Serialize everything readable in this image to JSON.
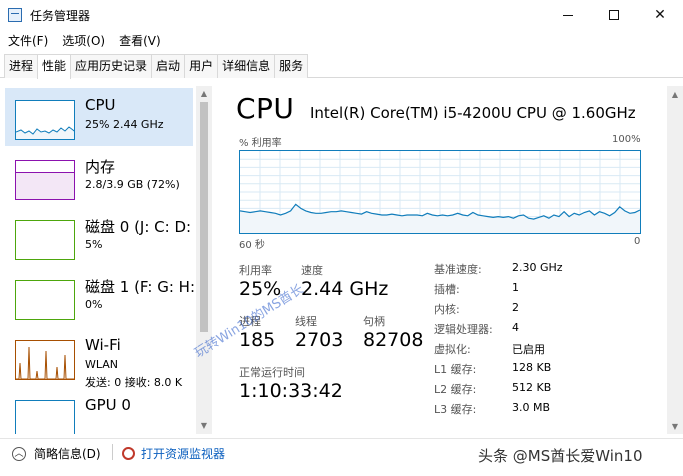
{
  "window": {
    "title": "任务管理器"
  },
  "menu": {
    "items": [
      "文件(F)",
      "选项(O)",
      "查看(V)"
    ]
  },
  "tabs": [
    "进程",
    "性能",
    "应用历史记录",
    "启动",
    "用户",
    "详细信息",
    "服务"
  ],
  "sidebar": {
    "items": [
      {
        "name": "CPU",
        "sub": "25% 2.44 GHz",
        "sub2": "",
        "color": "#117dbb"
      },
      {
        "name": "内存",
        "sub": "2.8/3.9 GB (72%)",
        "sub2": "",
        "color": "#8b12ae"
      },
      {
        "name": "磁盘 0 (J: C: D:",
        "sub": "5%",
        "sub2": "",
        "color": "#4da60c"
      },
      {
        "name": "磁盘 1 (F: G: H:",
        "sub": "0%",
        "sub2": "",
        "color": "#4da60c"
      },
      {
        "name": "Wi-Fi",
        "sub": "WLAN",
        "sub2": "发送: 0 接收: 8.0 K",
        "color": "#a74f01"
      },
      {
        "name": "GPU 0",
        "sub": "",
        "sub2": "",
        "color": "#117dbb"
      }
    ]
  },
  "main": {
    "title": "CPU",
    "model": "Intel(R) Core(TM) i5-4200U CPU @ 1.60GHz",
    "graph_label_left": "% 利用率",
    "graph_label_right": "100%",
    "time_left": "60 秒",
    "time_right": "0",
    "utilization_history_percent": [
      27,
      26,
      25,
      26,
      27,
      26,
      25,
      24,
      22,
      24,
      27,
      35,
      30,
      27,
      25,
      24,
      24,
      25,
      26,
      26,
      27,
      26,
      25,
      24,
      23,
      26,
      24,
      23,
      22,
      22,
      23,
      22,
      21,
      22,
      22,
      22,
      21,
      24,
      22,
      21,
      22,
      21,
      22,
      24,
      22,
      21,
      25,
      22,
      21,
      20,
      19,
      20,
      19,
      20,
      18,
      21,
      22,
      18,
      17,
      19,
      21,
      18,
      22,
      20,
      26,
      20,
      24,
      22,
      25,
      27,
      22,
      26,
      24,
      21,
      25,
      32,
      27,
      24,
      25,
      28
    ],
    "stats": {
      "util_label": "利用率",
      "util_value": "25%",
      "speed_label": "速度",
      "speed_value": "2.44 GHz",
      "proc_label": "进程",
      "proc_value": "185",
      "thread_label": "线程",
      "thread_value": "2703",
      "handle_label": "句柄",
      "handle_value": "82708",
      "uptime_label": "正常运行时间",
      "uptime_value": "1:10:33:42"
    },
    "specs": [
      {
        "label": "基准速度:",
        "value": "2.30 GHz"
      },
      {
        "label": "插槽:",
        "value": "1"
      },
      {
        "label": "内核:",
        "value": "2"
      },
      {
        "label": "逻辑处理器:",
        "value": "4"
      },
      {
        "label": "虚拟化:",
        "value": "已启用"
      },
      {
        "label": "L1 缓存:",
        "value": "128 KB"
      },
      {
        "label": "L2 缓存:",
        "value": "512 KB"
      },
      {
        "label": "L3 缓存:",
        "value": "3.0 MB"
      }
    ]
  },
  "footer": {
    "fewer_details": "简略信息(D)",
    "open_monitor": "打开资源监视器",
    "brand": "头条 @MS酋长爱Win10"
  },
  "watermark": "玩转Win10的MS酋长"
}
